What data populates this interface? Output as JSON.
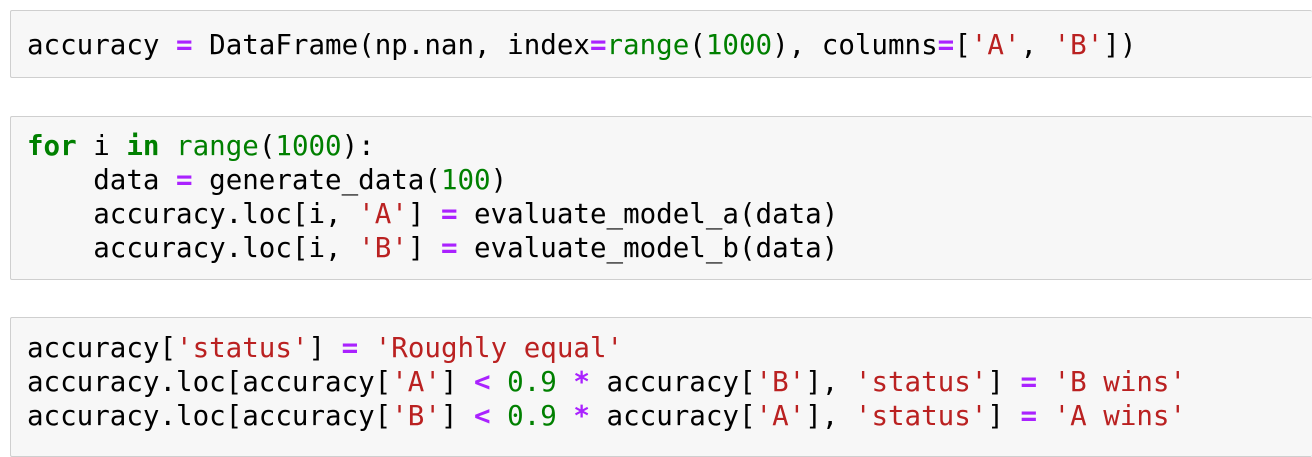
{
  "cells": [
    {
      "lines": [
        [
          {
            "t": "accuracy ",
            "c": ""
          },
          {
            "t": "=",
            "c": "o"
          },
          {
            "t": " DataFrame(np.nan, index",
            "c": ""
          },
          {
            "t": "=",
            "c": "o"
          },
          {
            "t": "range",
            "c": "b"
          },
          {
            "t": "(",
            "c": ""
          },
          {
            "t": "1000",
            "c": "n"
          },
          {
            "t": "), columns",
            "c": ""
          },
          {
            "t": "=",
            "c": "o"
          },
          {
            "t": "[",
            "c": ""
          },
          {
            "t": "'A'",
            "c": "s"
          },
          {
            "t": ", ",
            "c": ""
          },
          {
            "t": "'B'",
            "c": "s"
          },
          {
            "t": "])",
            "c": ""
          }
        ]
      ]
    },
    {
      "lines": [
        [
          {
            "t": "for",
            "c": "k"
          },
          {
            "t": " i ",
            "c": ""
          },
          {
            "t": "in",
            "c": "k"
          },
          {
            "t": " ",
            "c": ""
          },
          {
            "t": "range",
            "c": "b"
          },
          {
            "t": "(",
            "c": ""
          },
          {
            "t": "1000",
            "c": "n"
          },
          {
            "t": "):",
            "c": ""
          }
        ],
        [
          {
            "t": "    data ",
            "c": ""
          },
          {
            "t": "=",
            "c": "o"
          },
          {
            "t": " generate_data(",
            "c": ""
          },
          {
            "t": "100",
            "c": "n"
          },
          {
            "t": ")",
            "c": ""
          }
        ],
        [
          {
            "t": "    accuracy.loc[i, ",
            "c": ""
          },
          {
            "t": "'A'",
            "c": "s"
          },
          {
            "t": "] ",
            "c": ""
          },
          {
            "t": "=",
            "c": "o"
          },
          {
            "t": " evaluate_model_a(data)",
            "c": ""
          }
        ],
        [
          {
            "t": "    accuracy.loc[i, ",
            "c": ""
          },
          {
            "t": "'B'",
            "c": "s"
          },
          {
            "t": "] ",
            "c": ""
          },
          {
            "t": "=",
            "c": "o"
          },
          {
            "t": " evaluate_model_b(data)",
            "c": ""
          }
        ]
      ]
    },
    {
      "lines": [
        [
          {
            "t": "accuracy[",
            "c": ""
          },
          {
            "t": "'status'",
            "c": "s"
          },
          {
            "t": "] ",
            "c": ""
          },
          {
            "t": "=",
            "c": "o"
          },
          {
            "t": " ",
            "c": ""
          },
          {
            "t": "'Roughly equal'",
            "c": "s"
          }
        ],
        [
          {
            "t": "accuracy.loc[accuracy[",
            "c": ""
          },
          {
            "t": "'A'",
            "c": "s"
          },
          {
            "t": "] ",
            "c": ""
          },
          {
            "t": "<",
            "c": "o"
          },
          {
            "t": " ",
            "c": ""
          },
          {
            "t": "0.9",
            "c": "n"
          },
          {
            "t": " ",
            "c": ""
          },
          {
            "t": "*",
            "c": "o"
          },
          {
            "t": " accuracy[",
            "c": ""
          },
          {
            "t": "'B'",
            "c": "s"
          },
          {
            "t": "], ",
            "c": ""
          },
          {
            "t": "'status'",
            "c": "s"
          },
          {
            "t": "] ",
            "c": ""
          },
          {
            "t": "=",
            "c": "o"
          },
          {
            "t": " ",
            "c": ""
          },
          {
            "t": "'B wins'",
            "c": "s"
          }
        ],
        [
          {
            "t": "accuracy.loc[accuracy[",
            "c": ""
          },
          {
            "t": "'B'",
            "c": "s"
          },
          {
            "t": "] ",
            "c": ""
          },
          {
            "t": "<",
            "c": "o"
          },
          {
            "t": " ",
            "c": ""
          },
          {
            "t": "0.9",
            "c": "n"
          },
          {
            "t": " ",
            "c": ""
          },
          {
            "t": "*",
            "c": "o"
          },
          {
            "t": " accuracy[",
            "c": ""
          },
          {
            "t": "'A'",
            "c": "s"
          },
          {
            "t": "], ",
            "c": ""
          },
          {
            "t": "'status'",
            "c": "s"
          },
          {
            "t": "] ",
            "c": ""
          },
          {
            "t": "=",
            "c": "o"
          },
          {
            "t": " ",
            "c": ""
          },
          {
            "t": "'A wins'",
            "c": "s"
          }
        ]
      ]
    }
  ]
}
